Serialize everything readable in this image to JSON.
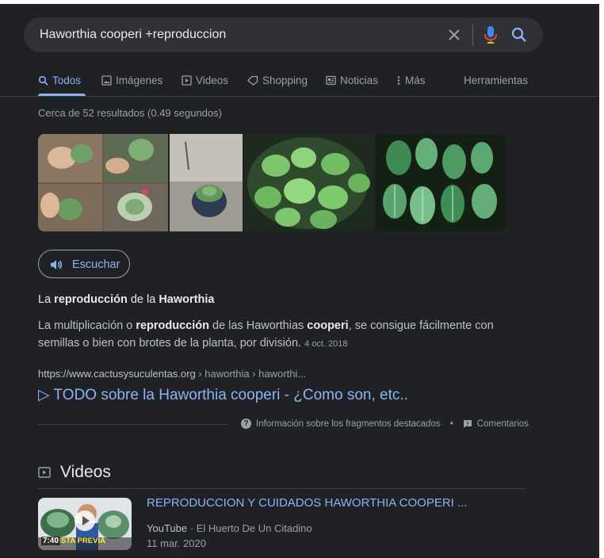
{
  "search": {
    "query": "Haworthia cooperi +reproduccion"
  },
  "tabs": [
    {
      "label": "Todos",
      "icon": "search-icon"
    },
    {
      "label": "Imágenes",
      "icon": "image-icon"
    },
    {
      "label": "Videos",
      "icon": "video-icon"
    },
    {
      "label": "Shopping",
      "icon": "tag-icon"
    },
    {
      "label": "Noticias",
      "icon": "news-icon"
    },
    {
      "label": "Más",
      "icon": "more-vert-icon"
    },
    {
      "label": "Herramientas",
      "icon": ""
    }
  ],
  "result_stats": "Cerca de 52 resultados (0.49 segundos)",
  "listen": {
    "label": "Escuchar",
    "icon": "speaker-icon"
  },
  "snippet": {
    "title_parts": [
      "La ",
      "reproducción",
      " de la ",
      "Haworthia"
    ],
    "body_parts": [
      "La multiplicación o ",
      "reproducción",
      " de las Haworthias ",
      "cooperi",
      ", se consigue fácilmente con semillas o bien con brotes de la planta, por división."
    ],
    "date": "4 oct. 2018"
  },
  "result": {
    "domain": "https://www.cactusysuculentas.org",
    "path": " › haworthia › haworthi...",
    "title": "▷ TODO sobre la Haworthia cooperi - ¿Como son, etc.."
  },
  "snippet_footer": {
    "info_label": "Información sobre los fragmentos destacados",
    "separator": "•",
    "feedback_label": "Comentarios"
  },
  "videos": {
    "header": "Videos",
    "items": [
      {
        "title": "REPRODUCCION Y CUIDADOS HAWORTHIA COOPERI ...",
        "source": "YouTube",
        "separator": "·",
        "channel": "El Huerto De Un Citadino",
        "date": "11 mar. 2020",
        "duration": "7:40",
        "thumb_text": "VISTA PREVIA"
      }
    ]
  },
  "colors": {
    "background": "#202124",
    "link": "#8ab4f8",
    "text": "#bdc1c6",
    "muted": "#9aa0a6"
  }
}
